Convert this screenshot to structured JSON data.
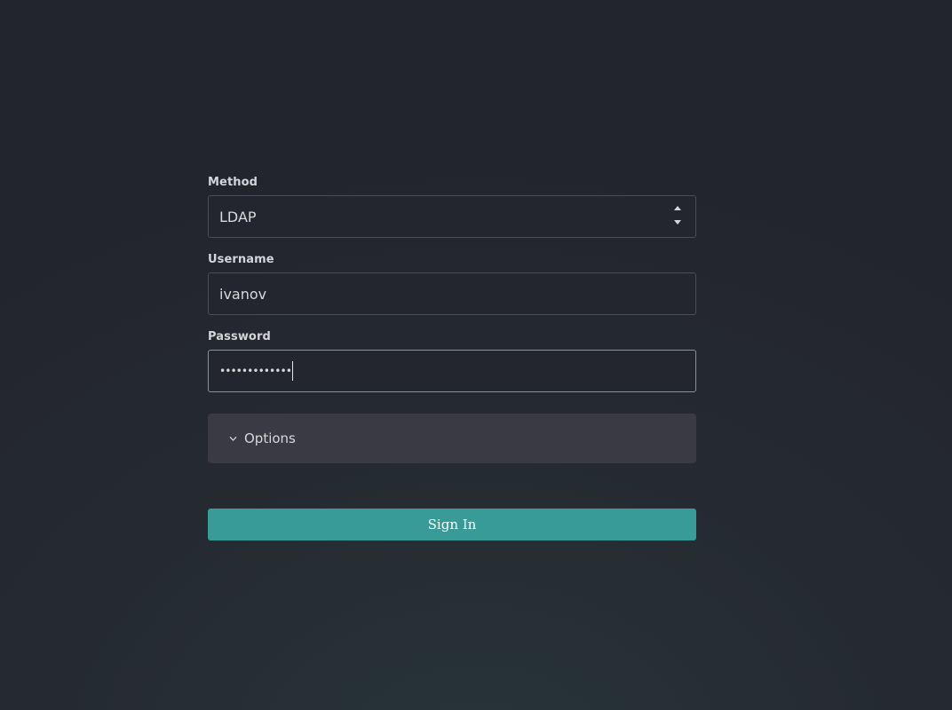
{
  "login_form": {
    "method": {
      "label": "Method",
      "value": "LDAP"
    },
    "username": {
      "label": "Username",
      "value": "ivanov"
    },
    "password": {
      "label": "Password",
      "masked_value": "•••••••••••••"
    },
    "options": {
      "label": "Options",
      "icon": "chevron-down-icon"
    },
    "submit": {
      "label": "Sign In"
    }
  },
  "colors": {
    "background": "#23252d",
    "input_background": "#23262e",
    "input_border": "#4a4d56",
    "options_background": "#393a43",
    "primary_button": "#389b97",
    "text": "#d7d8dc"
  }
}
